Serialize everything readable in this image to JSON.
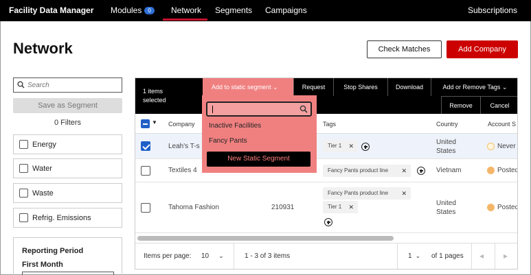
{
  "nav": {
    "brand": "Facility Data Manager",
    "modules": "Modules",
    "modules_badge": "0",
    "network": "Network",
    "segments": "Segments",
    "campaigns": "Campaigns",
    "subscriptions": "Subscriptions"
  },
  "page": {
    "title": "Network",
    "check_matches": "Check Matches",
    "add_company": "Add Company"
  },
  "sidebar": {
    "search_placeholder": "Search",
    "save_segment": "Save as Segment",
    "filters_count": "0 Filters",
    "filters": [
      "Energy",
      "Water",
      "Waste",
      "Refrig. Emissions"
    ],
    "reporting_title": "Reporting Period",
    "first_month": "First Month"
  },
  "toolbar": {
    "selected_line1": "1 items",
    "selected_line2": "selected",
    "add_static": "Add to static segment ⌄",
    "request": "Request",
    "stop_shares": "Stop Shares",
    "download": "Download",
    "add_remove_tags": "Add or Remove Tags ⌄",
    "remove": "Remove",
    "cancel": "Cancel"
  },
  "table": {
    "headers": {
      "company": "Company",
      "tags": "Tags",
      "country": "Country",
      "account": "Account S"
    },
    "rows": [
      {
        "company": "Leah's T-s",
        "id": "",
        "tags": [
          "Tier 1"
        ],
        "country_1": "United",
        "country_2": "States",
        "status": "Never",
        "status_color": "#fde9b8",
        "checked": true
      },
      {
        "company": "Textiles 4",
        "id": "",
        "tags": [
          "Fancy Pants product line"
        ],
        "country_1": "Vietnam",
        "country_2": "",
        "status": "Posted",
        "status_color": "#f5b66a",
        "checked": false
      },
      {
        "company": "Tahoma Fashion",
        "id": "210931",
        "tags": [
          "Fancy Pants product line",
          "Tier 1"
        ],
        "country_1": "United",
        "country_2": "States",
        "status": "Posted",
        "status_color": "#f5b66a",
        "checked": false
      }
    ]
  },
  "footer": {
    "items_per_page_label": "Items per page:",
    "items_per_page_value": "10",
    "range": "1 - 3 of 3 items",
    "page_value": "1",
    "pages_text": "of 1 pages"
  },
  "dropdown": {
    "search_value": "",
    "options": [
      "Inactive Facilities",
      "Fancy Pants"
    ],
    "new_segment": "New Static Segment"
  },
  "colors": {
    "accent": "#c00",
    "highlight": "#f08080",
    "selected_blue": "#1f5fc8"
  }
}
